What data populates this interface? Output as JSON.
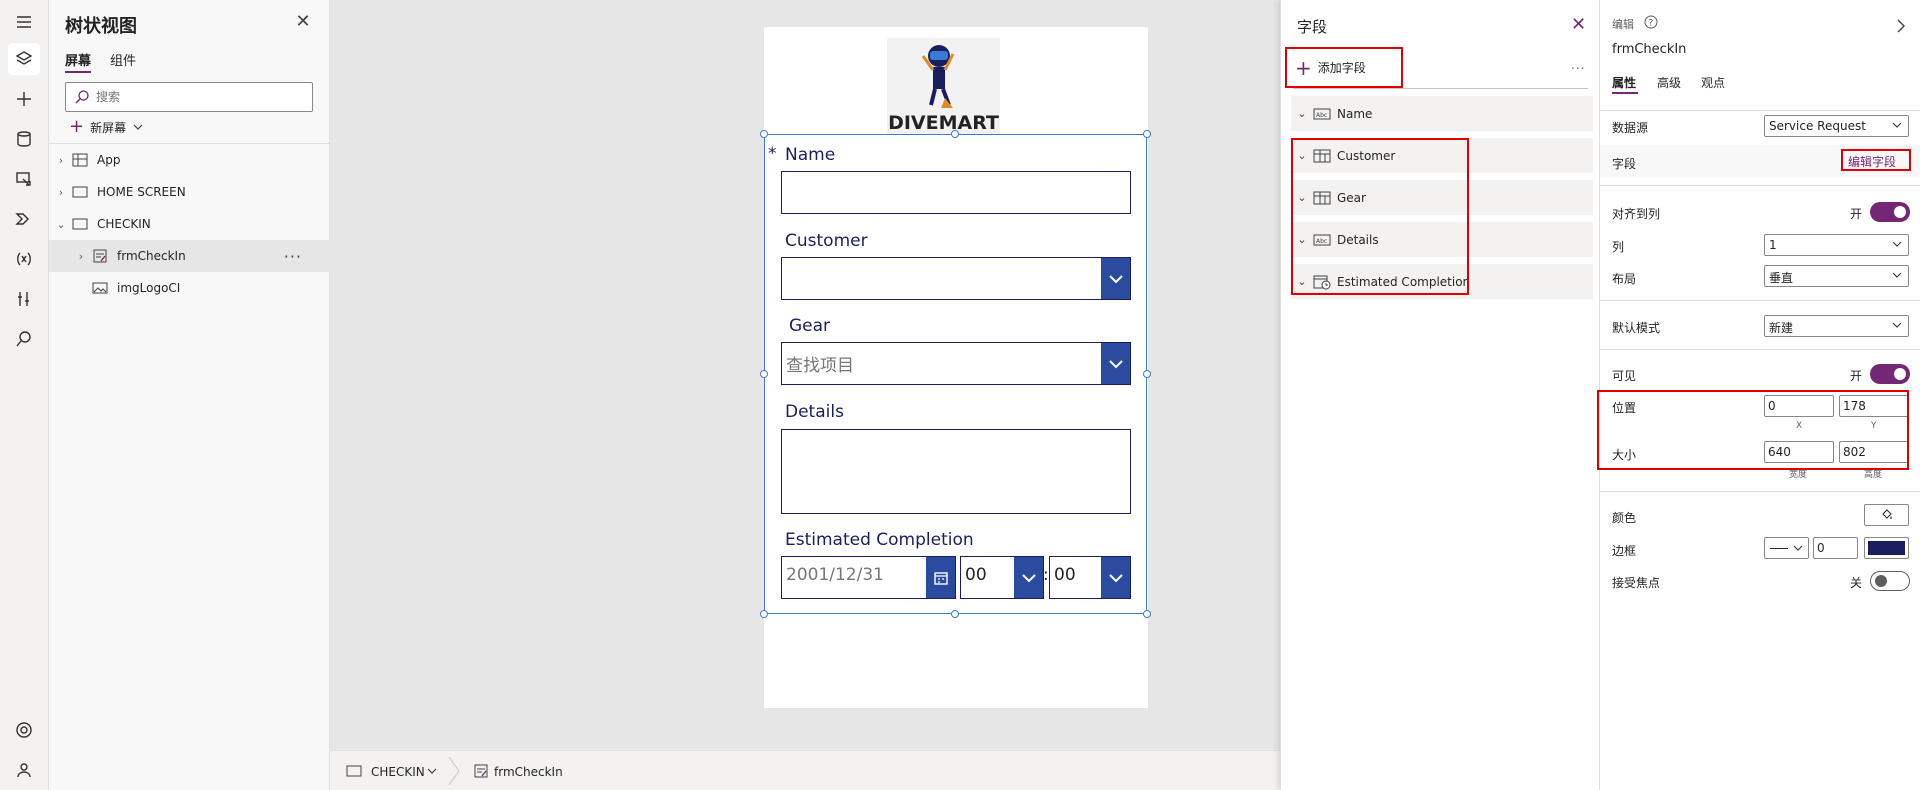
{
  "tree": {
    "title": "树状视图",
    "tabs": [
      "屏幕",
      "组件"
    ],
    "search_placeholder": "搜索",
    "new_screen": "新屏幕",
    "nodes": [
      "App",
      "HOME SCREEN",
      "CHECKIN",
      "frmCheckIn",
      "imgLogoCI"
    ]
  },
  "canvas": {
    "logo_text": "DIVEMART",
    "form": {
      "required_mark": "*",
      "name_label": "Name",
      "customer_label": "Customer",
      "gear_label": "Gear",
      "gear_placeholder": "查找项目",
      "details_label": "Details",
      "completion_label": "Estimated Completion",
      "date_placeholder": "2001/12/31",
      "hour_value": "00",
      "minute_value": "00",
      "time_separator": ":"
    }
  },
  "statusbar": {
    "screen": "CHECKIN",
    "control": "frmCheckIn"
  },
  "fields_panel": {
    "title": "字段",
    "add_field": "添加字段",
    "more": "...",
    "fields": [
      "Name",
      "Customer",
      "Gear",
      "Details",
      "Estimated Completion"
    ]
  },
  "props": {
    "header": "编辑",
    "control_name": "frmCheckIn",
    "tabs": [
      "属性",
      "高级",
      "观点"
    ],
    "datasource_label": "数据源",
    "datasource_value": "Service Request",
    "fields_label": "字段",
    "edit_fields_link": "编辑字段",
    "snap_label": "对齐到列",
    "snap_state": "开",
    "columns_label": "列",
    "columns_value": "1",
    "layout_label": "布局",
    "layout_value": "垂直",
    "default_mode_label": "默认模式",
    "default_mode_value": "新建",
    "visible_label": "可见",
    "visible_state": "开",
    "position_label": "位置",
    "position_x": "0",
    "position_y": "178",
    "position_x_caption": "X",
    "position_y_caption": "Y",
    "size_label": "大小",
    "size_width": "640",
    "size_height": "802",
    "size_width_caption": "宽度",
    "size_height_caption": "高度",
    "color_label": "颜色",
    "border_label": "边框",
    "border_width": "0",
    "border_color": "#1b1e5e",
    "focus_label": "接受焦点",
    "focus_state": "关"
  },
  "colors": {
    "accent": "#742774",
    "form_blue": "#1b1e5e",
    "dropdown_blue": "#2b4ba0",
    "highlight_red": "#e00000",
    "selection_blue": "#3a7bd5"
  }
}
